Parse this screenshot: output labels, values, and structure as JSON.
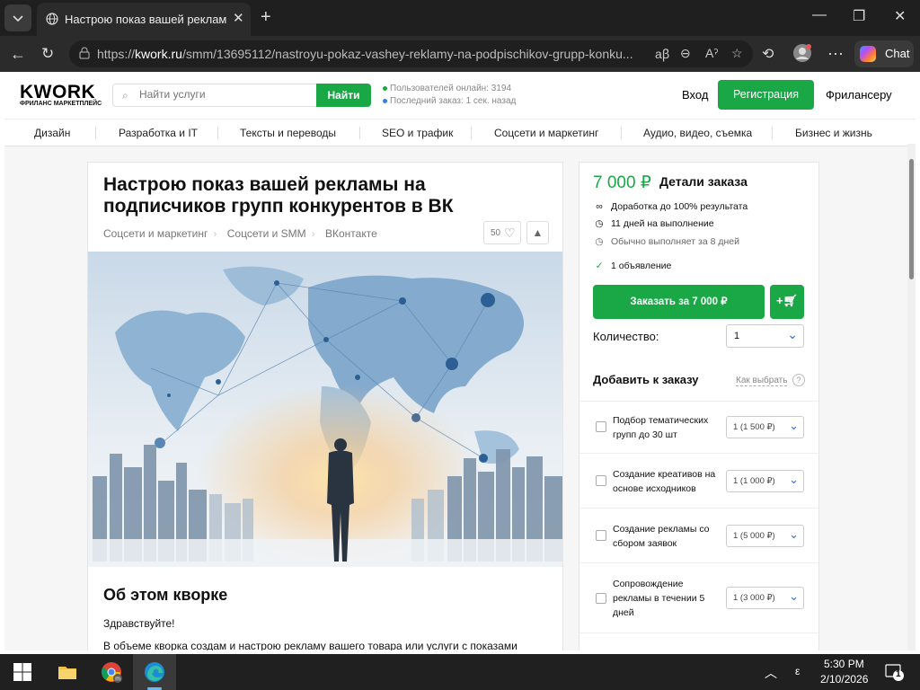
{
  "browser": {
    "tab_title": "Настрою показ вашей рекламы на подписчиков групп конкурентов в ВК",
    "url_prefix": "https://",
    "url_domain": "kwork.ru",
    "url_path": "/smm/13695112/nastroyu-pokaz-vashey-reklamy-na-podpischikov-grupp-konku...",
    "copilot_label": "Chat"
  },
  "site": {
    "logo": "KWORK",
    "logo_sub": "ФРИЛАНС МАРКЕТПЛЕЙС",
    "search_placeholder": "Найти услуги",
    "search_button": "Найти",
    "online_users": "Пользователей онлайн: 3194",
    "last_order": "Последний заказ: 1 сек. назад",
    "login": "Вход",
    "register": "Регистрация",
    "freelancer": "Фрилансеру",
    "brand_color": "#1aa846"
  },
  "categories": [
    "Дизайн",
    "Разработка и IT",
    "Тексты и переводы",
    "SEO и трафик",
    "Соцсети и маркетинг",
    "Аудио, видео, съемка",
    "Бизнес и жизнь"
  ],
  "kwork": {
    "title": "Настрою показ вашей рекламы на подписчиков групп конкурентов в ВК",
    "breadcrumbs": [
      "Соцсети и маркетинг",
      "Соцсети и SMM",
      "ВКонтакте"
    ],
    "favorites": "50",
    "about_heading": "Об этом кворке",
    "greeting": "Здравствуйте!",
    "description": "В объеме кворка создам и настрою рекламу вашего товара или услуги с показами"
  },
  "order": {
    "price": "7 000 ₽",
    "details_title": "Детали заказа",
    "features": [
      {
        "icon": "infinity-icon",
        "text": "Доработка до 100% результата"
      },
      {
        "icon": "clock-icon",
        "text": "11 дней на выполнение"
      },
      {
        "icon": "clock-icon",
        "text": "Обычно выполняет за 8 дней"
      },
      {
        "icon": "check-icon",
        "text": "1 объявление"
      }
    ],
    "order_button": "Заказать за 7 000 ₽",
    "cart_button": "+",
    "quantity_label": "Количество:",
    "quantity_value": "1",
    "add_title": "Добавить к заказу",
    "how_to_choose": "Как выбрать",
    "extras": [
      {
        "label": "Подбор тематических групп до 30 шт",
        "value": "1 (1 500 ₽)"
      },
      {
        "label": "Создание креативов на основе исходников",
        "value": "1 (1 000 ₽)"
      },
      {
        "label": "Создание рекламы со сбором заявок",
        "value": "1 (5 000 ₽)"
      },
      {
        "label": "Сопровождение рекламы в течении 5 дней",
        "value": "1 (3 000 ₽)"
      }
    ]
  },
  "taskbar": {
    "time": "5:30 PM",
    "date": "2/10/2026",
    "notifications": "1",
    "lang_glyph": "ε"
  }
}
